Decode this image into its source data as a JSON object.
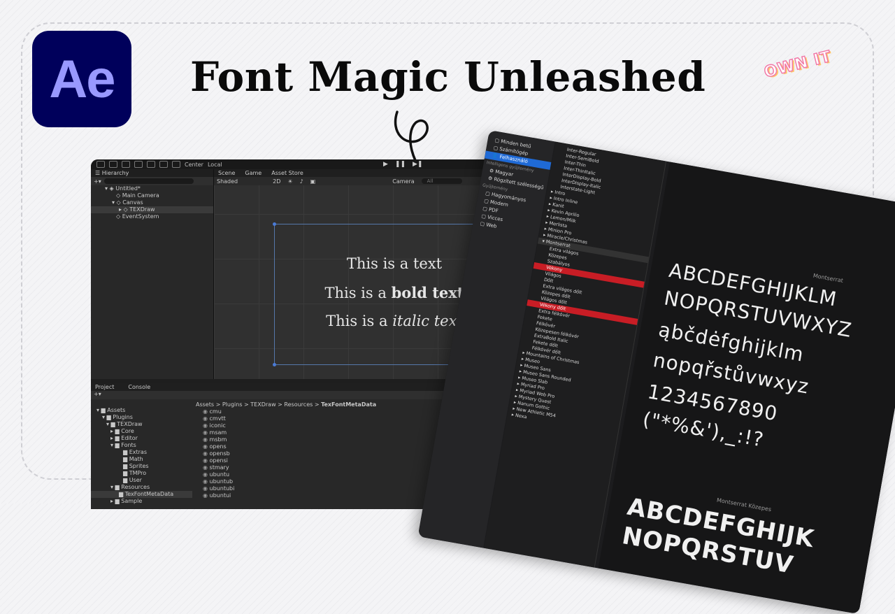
{
  "thumbnail": {
    "headline": "Font Magic Unleashed",
    "logo_text": "Ae",
    "sticker": "OWN IT",
    "colors": {
      "ae_bg": "#00005b",
      "ae_text": "#9999ff",
      "sticker_stroke": "#f17aa8"
    }
  },
  "unity": {
    "toolbar": {
      "pivot": "Center",
      "space": "Local"
    },
    "hierarchy": {
      "tab": "Hierarchy",
      "items": [
        "Untitled*",
        "Main Camera",
        "Canvas",
        "TEXDraw",
        "EventSystem"
      ]
    },
    "scene": {
      "tabs": [
        "Scene",
        "Game",
        "Asset Store"
      ],
      "shading": "Shaded",
      "mode": "2D",
      "camera": "Camera",
      "search_placeholder": "All",
      "text_lines": [
        "This is a text",
        "This is a ",
        "bold text",
        "This is a ",
        "italic text"
      ]
    },
    "project": {
      "tabs": [
        "Project",
        "Console"
      ],
      "breadcrumb": [
        "Assets",
        "Plugins",
        "TEXDraw",
        "Resources",
        "TexFontMetaData"
      ],
      "tree": [
        "Assets",
        "Plugins",
        "TEXDraw",
        "Core",
        "Editor",
        "Fonts",
        "Extras",
        "Math",
        "Sprites",
        "TMPro",
        "User",
        "Resources",
        "TexFontMetaData",
        "Sample"
      ],
      "files": [
        "cmu",
        "cmvtt",
        "iconic",
        "msam",
        "msbm",
        "opens",
        "opensb",
        "opensi",
        "stmary",
        "ubuntu",
        "ubuntub",
        "ubuntubi",
        "ubuntui"
      ]
    }
  },
  "fontbook": {
    "sidebar": {
      "items": [
        "Minden betű",
        "Számítógép",
        "Felhasználó"
      ],
      "smart_header": "Intelligens gyűjtemény",
      "smart_items": [
        "Magyar",
        "Rögzített szélességű"
      ],
      "collections_header": "Gyűjtemény",
      "collections": [
        "Hagyományos",
        "Modern",
        "PDF",
        "Vicces",
        "Web"
      ]
    },
    "families_top": [
      "Inter-Regular",
      "Inter-SemiBold",
      "Inter-Thin",
      "Inter-ThinItalic",
      "InterDisplay-Bold",
      "InterDisplay-Italic",
      "Interstate-Light",
      "Intro",
      "Intro Inline",
      "Kanit",
      "Kevin Aprilio",
      "Lemon/Milk",
      "Merlista",
      "Minion Pro",
      "Miracle/Christmas"
    ],
    "family_selected": "Montserrat",
    "styles": [
      "Extra világos",
      "Közepes",
      "Szabályos",
      "Világos",
      "Dőlt",
      "Extra világos dőlt",
      "Közepes dőlt",
      "Világos dőlt",
      "Vékony dőlt",
      "Extra félkövér",
      "Fekete",
      "Félkövér",
      "Közepesen félkövér",
      "ExtraBold Italic",
      "Fekete dőlt",
      "Félkövér dőlt"
    ],
    "styles_red": [
      "Vékony",
      "Vékony dőlt"
    ],
    "families_bottom": [
      "Mountains of Christmas",
      "Museo",
      "Museo Sans",
      "Museo Sans Rounded",
      "Museo Slab",
      "Myriad Pro",
      "Myriad Web Pro",
      "Mystery Quest",
      "Nanum Gothic",
      "New Athletic M54",
      "Nexa"
    ],
    "preview": {
      "caption_1": "Montserrat",
      "lines": [
        "ABCDEFGHIJKLM",
        "NOPQRSTUVWXYZ",
        "ąbčdėfghijklm",
        "nopqřstůvwxyz",
        "1234567890",
        "(\"*%&'),_:!?"
      ],
      "caption_2": "Montserrat Közepes",
      "bold_lines": [
        "ABCDEFGHIJK",
        "NOPQRSTUV"
      ]
    }
  }
}
